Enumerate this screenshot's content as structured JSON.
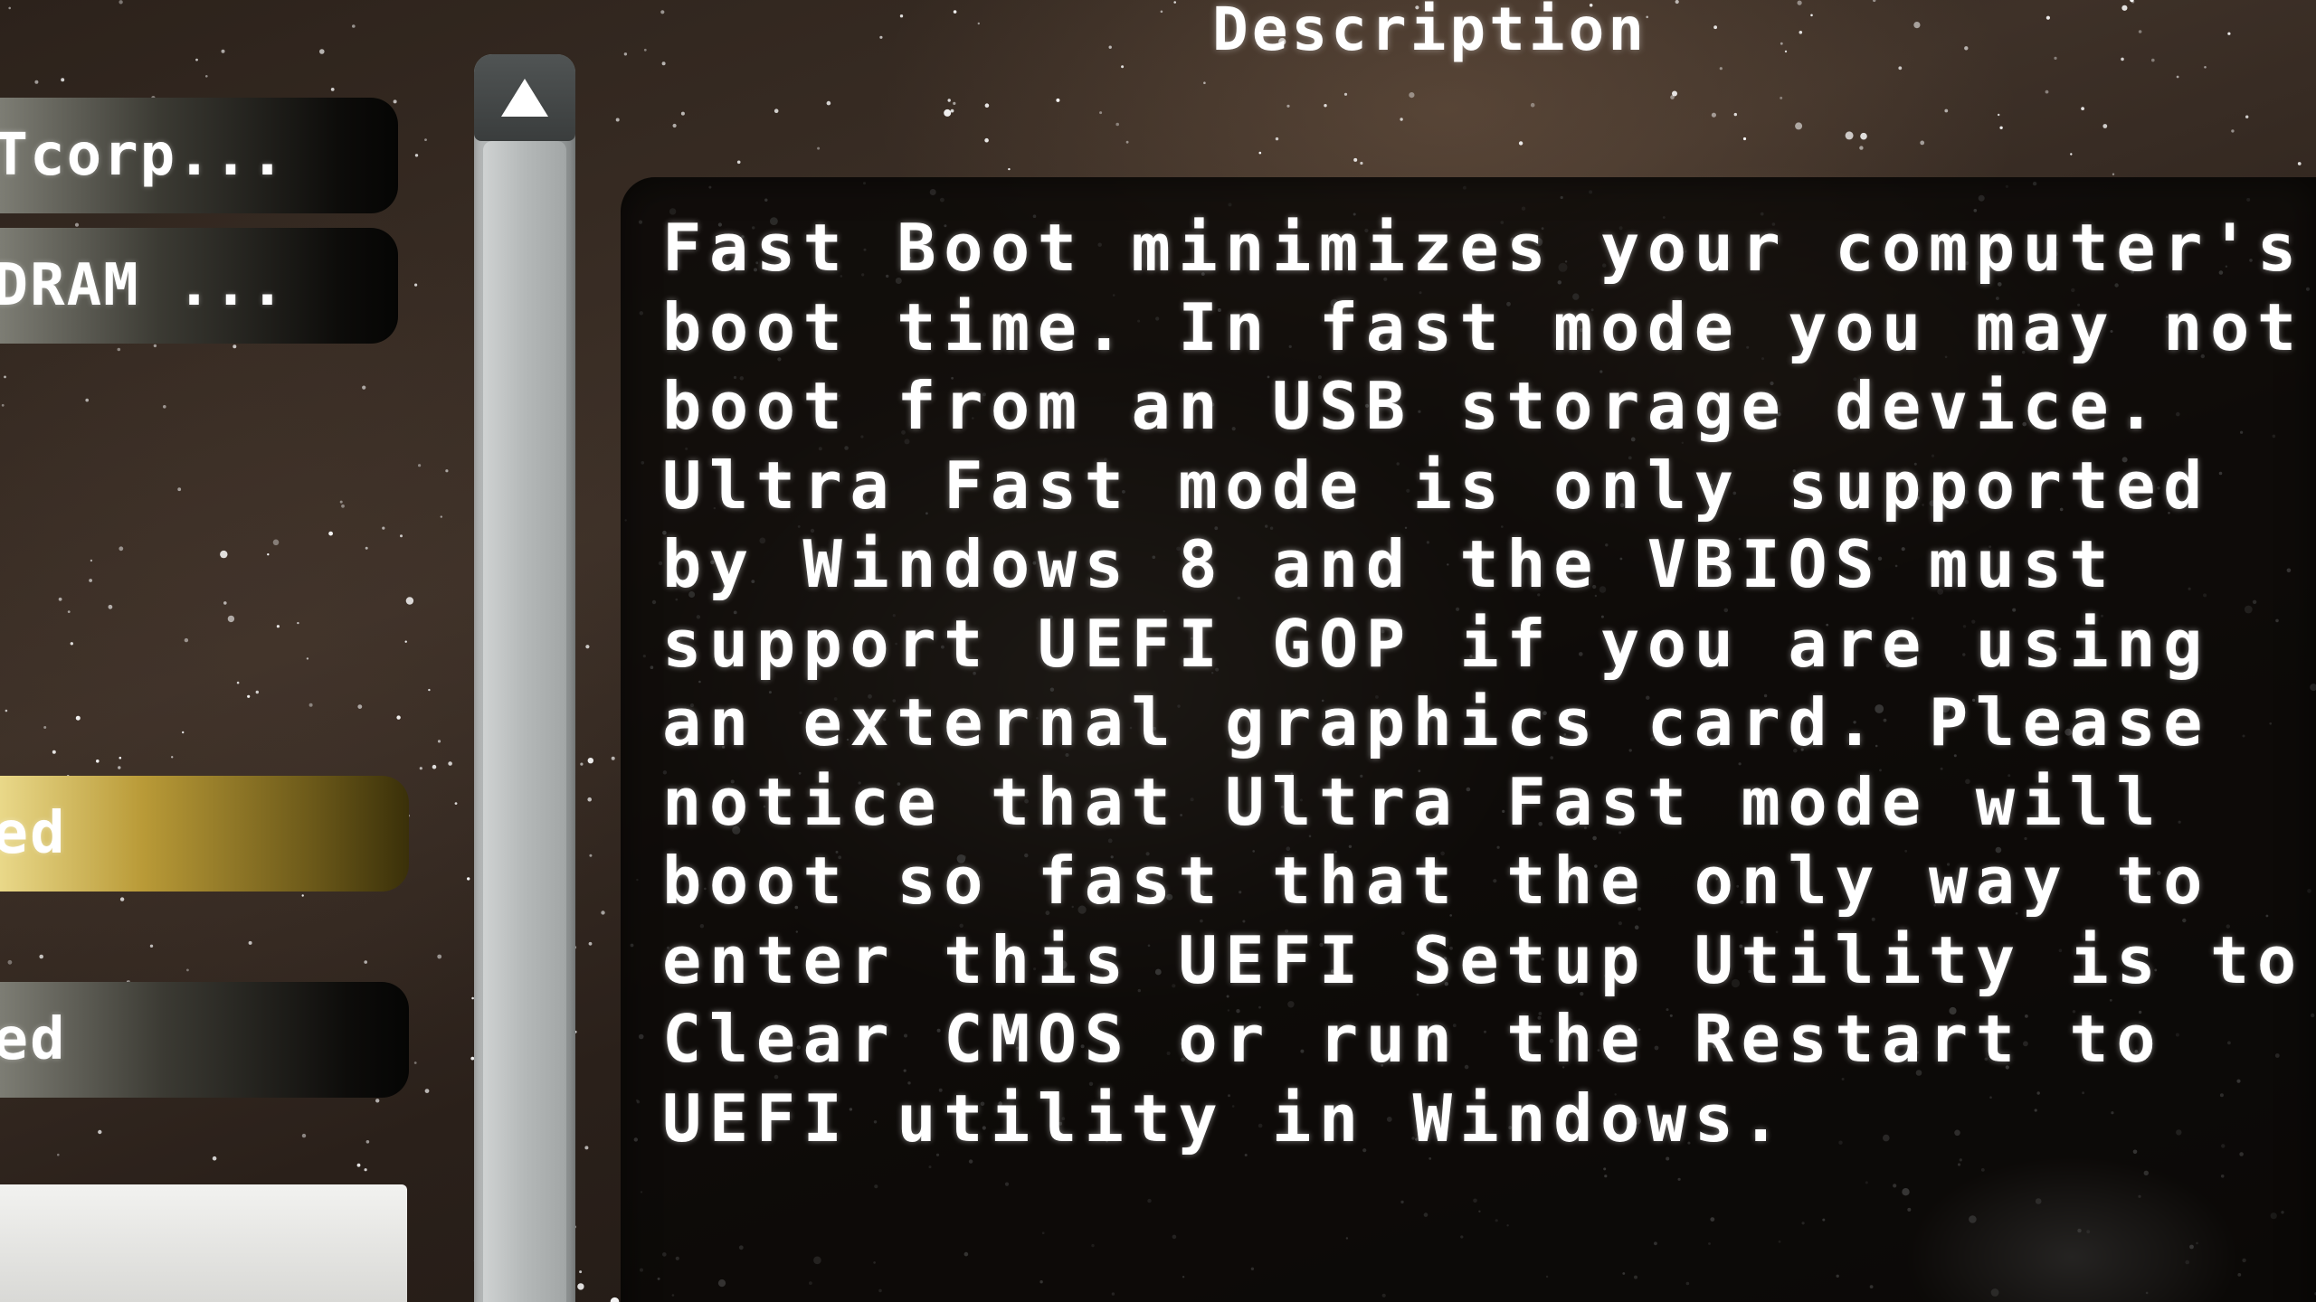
{
  "left_panel": {
    "options": [
      {
        "text": "STcorp...",
        "style": "dark"
      },
      {
        "text": "DDRAM ...",
        "style": "dark"
      },
      {
        "text": "led",
        "style": "gold"
      },
      {
        "text": "led",
        "style": "dark"
      }
    ]
  },
  "scrollbar": {
    "up_icon": "triangle-up-icon"
  },
  "description": {
    "title": "Description",
    "lines": [
      "Fast Boot minimizes your computer's",
      "boot time. In fast mode you may not",
      "boot from an USB storage device.",
      "Ultra Fast mode is only supported",
      "by Windows 8 and the VBIOS must",
      "support UEFI GOP if you are using",
      "an external graphics card. Please",
      "notice that Ultra Fast mode will",
      "boot so fast that the only way to",
      "enter this UEFI Setup Utility is to",
      "Clear CMOS or run the Restart to",
      "UEFI utility in Windows."
    ]
  },
  "colors": {
    "text": "#ffffff",
    "selected_option": "#b99a37",
    "scrollbar": "#a2a6a6"
  }
}
